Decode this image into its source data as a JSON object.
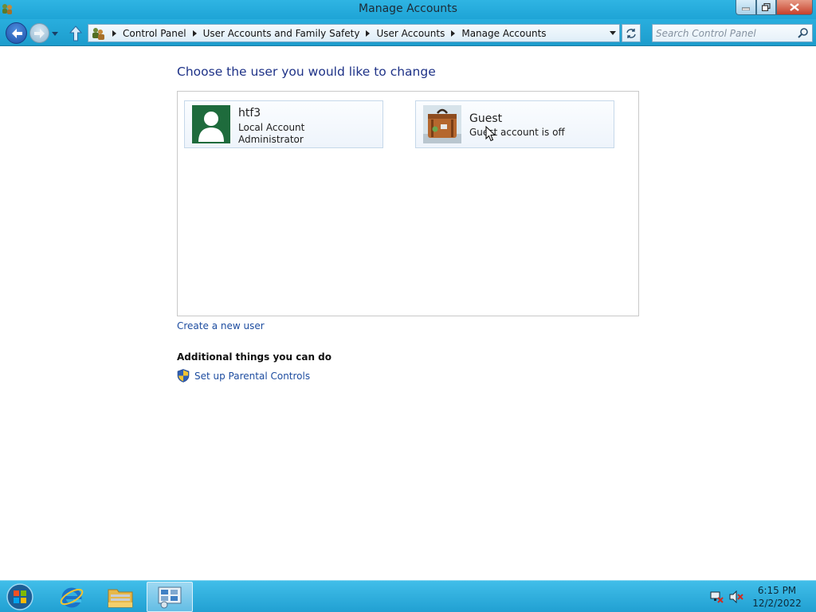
{
  "window": {
    "title": "Manage Accounts"
  },
  "nav": {
    "breadcrumbs": [
      "Control Panel",
      "User Accounts and Family Safety",
      "User Accounts",
      "Manage Accounts"
    ],
    "search_placeholder": "Search Control Panel"
  },
  "main": {
    "heading": "Choose the user you would like to change",
    "accounts": [
      {
        "name": "htf3",
        "lines": [
          "Local Account",
          "Administrator"
        ],
        "avatar": "user-silhouette-icon"
      },
      {
        "name": "Guest",
        "lines": [
          "Guest account is off"
        ],
        "avatar": "briefcase-icon"
      }
    ],
    "create_link": "Create a new user",
    "additional_heading": "Additional things you can do",
    "parental_link": "Set up Parental Controls"
  },
  "taskbar": {
    "time": "6:15 PM",
    "date": "12/2/2022"
  },
  "colors": {
    "titlebar": "#1ea4d6",
    "heading": "#1e3287",
    "link": "#1e4da0",
    "taskbar": "#21a0d2"
  }
}
